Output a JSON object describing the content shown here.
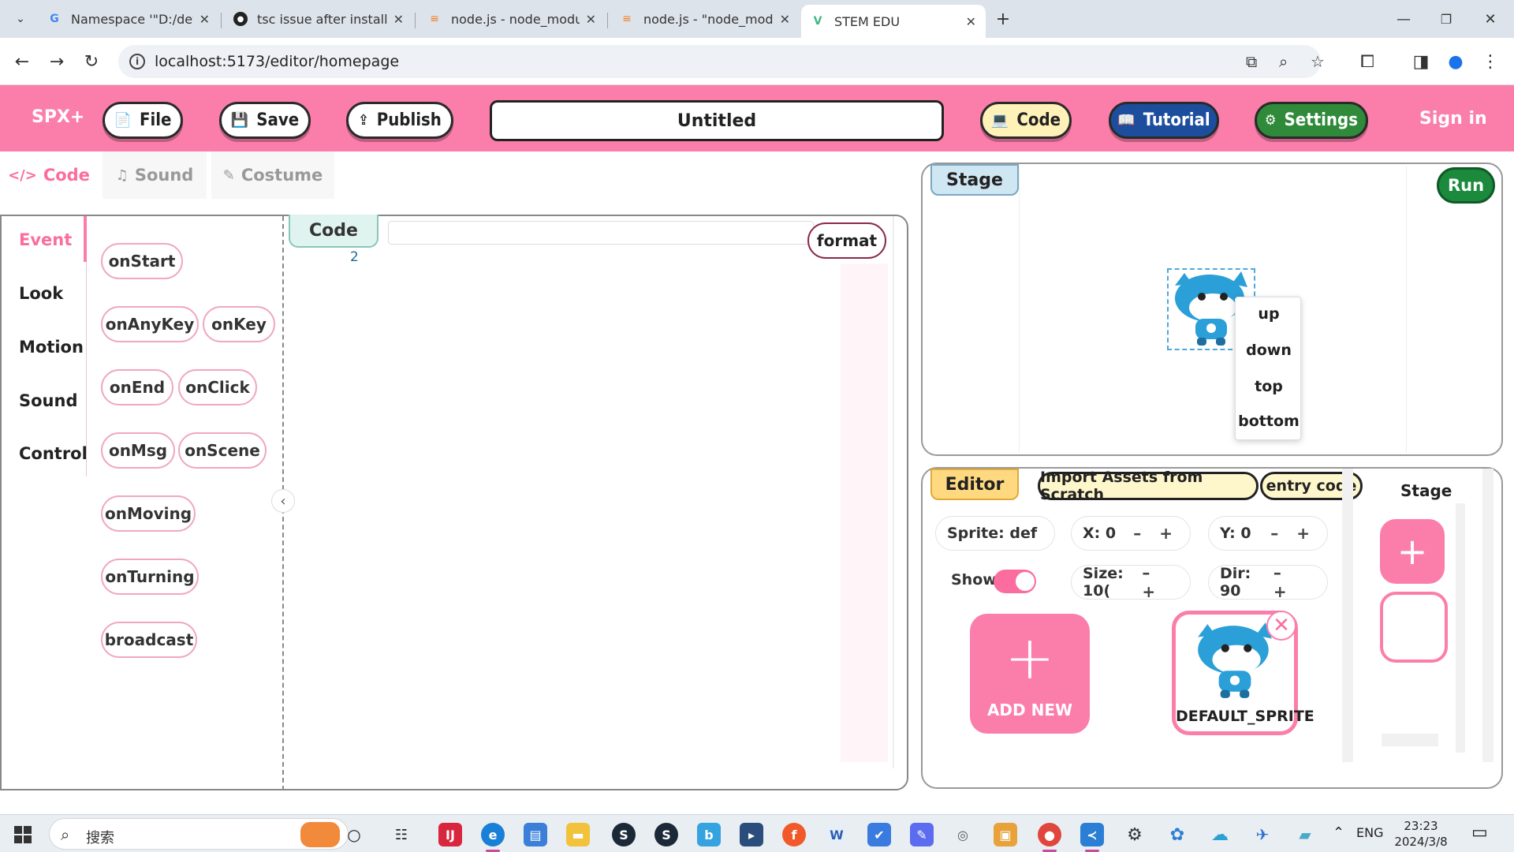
{
  "browser": {
    "tabs": [
      {
        "title": "Namespace '\"D:/devlop/front",
        "favicon": "google-icon"
      },
      {
        "title": "tsc issue after install package",
        "favicon": "github-icon"
      },
      {
        "title": "node.js - node_modules/mini",
        "favicon": "stackoverflow-icon"
      },
      {
        "title": "node.js - \"node_modules/mini",
        "favicon": "stackoverflow-icon"
      },
      {
        "title": "STEM EDU",
        "favicon": "vue-icon"
      }
    ],
    "url": "localhost:5173/editor/homepage"
  },
  "header": {
    "logo": "SPX+",
    "file": "File",
    "save": "Save",
    "publish": "Publish",
    "project_title": "Untitled",
    "code": "Code",
    "tutorial": "Tutorial",
    "settings": "Settings",
    "signin": "Sign in"
  },
  "subtabs": {
    "code": "Code",
    "sound": "Sound",
    "costume": "Costume"
  },
  "categories": [
    "Event",
    "Look",
    "Motion",
    "Sound",
    "Control"
  ],
  "blocks": {
    "onStart": "onStart",
    "onAnyKey": "onAnyKey",
    "onKey": "onKey",
    "onEnd": "onEnd",
    "onClick": "onClick",
    "onMsg": "onMsg",
    "onScene": "onScene",
    "onMoving": "onMoving",
    "onTurning": "onTurning",
    "broadcast": "broadcast"
  },
  "code_editor": {
    "tab": "Code",
    "line_number": "2",
    "format": "format"
  },
  "stage": {
    "tab": "Stage",
    "run": "Run",
    "context_menu": [
      "up",
      "down",
      "top",
      "bottom"
    ]
  },
  "editor": {
    "tab": "Editor",
    "import_btn": "Import Assets from Scratch",
    "entry_code_btn": "entry code",
    "sprite_field": "Sprite: def",
    "x_field": "X: 0",
    "y_field": "Y: 0",
    "show_label": "Show:",
    "size_field": "Size: 10(",
    "dir_field": "Dir: 90",
    "plus_minus": "– +",
    "add_new": "ADD NEW",
    "sprite_name": "DEFAULT_SPRITE",
    "stage_label": "Stage"
  },
  "taskbar": {
    "search_text": "搜索",
    "lang": "ENG",
    "time": "23:23",
    "date": "2024/3/8"
  },
  "colors": {
    "accent": "#fb7eaa",
    "run": "#1b8a3c",
    "tutorial": "#1d4e9e",
    "settings": "#2f8a3a",
    "code_btn": "#fff2b8"
  }
}
